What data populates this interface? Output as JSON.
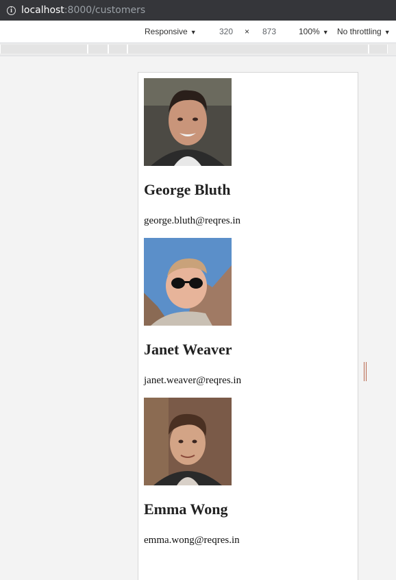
{
  "browser": {
    "url_host": "localhost",
    "url_path": ":8000/customers"
  },
  "devtools": {
    "device": "Responsive",
    "width": "320",
    "times": "×",
    "height": "873",
    "zoom": "100%",
    "throttling": "No throttling"
  },
  "customers": [
    {
      "name": "George Bluth",
      "email": "george.bluth@reqres.in",
      "avatar": "avatar-photo"
    },
    {
      "name": "Janet Weaver",
      "email": "janet.weaver@reqres.in",
      "avatar": "avatar-photo"
    },
    {
      "name": "Emma Wong",
      "email": "emma.wong@reqres.in",
      "avatar": "avatar-photo"
    }
  ],
  "colors": {
    "address_bar": "#35363a",
    "resize_handle": "#b8674d"
  }
}
